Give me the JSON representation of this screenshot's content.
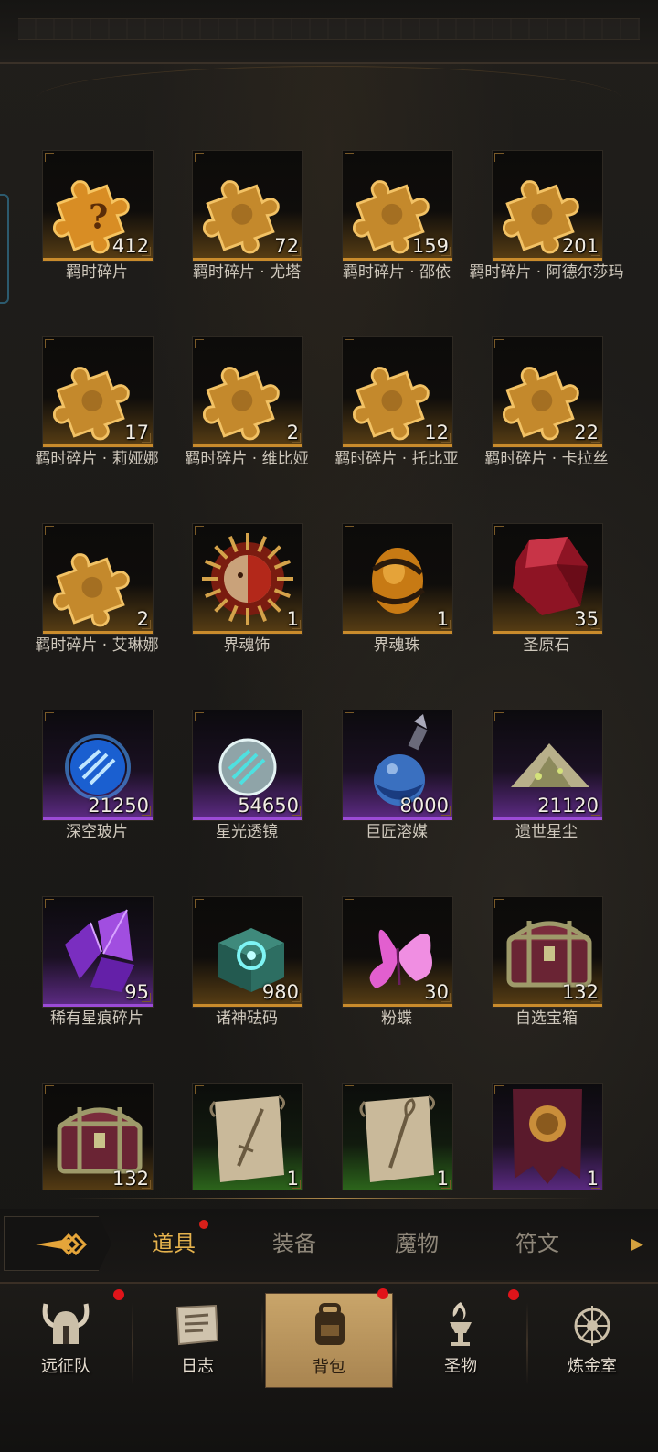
{
  "inventory": {
    "items": [
      {
        "label": "羁时碎片",
        "count": "412",
        "icon": "puzzle-question-icon",
        "rarity": "gold"
      },
      {
        "label": "羁时碎片 · 尤塔",
        "count": "72",
        "icon": "puzzle-piece-icon",
        "rarity": "gold"
      },
      {
        "label": "羁时碎片 · 邵依",
        "count": "159",
        "icon": "puzzle-piece-icon",
        "rarity": "gold"
      },
      {
        "label": "羁时碎片 · 阿德尔莎玛",
        "count": "201",
        "icon": "puzzle-piece-icon",
        "rarity": "gold"
      },
      {
        "label": "羁时碎片 · 莉娅娜",
        "count": "17",
        "icon": "puzzle-piece-icon",
        "rarity": "gold"
      },
      {
        "label": "羁时碎片 · 维比娅",
        "count": "2",
        "icon": "puzzle-piece-icon",
        "rarity": "gold"
      },
      {
        "label": "羁时碎片 · 托比亚",
        "count": "12",
        "icon": "puzzle-piece-icon",
        "rarity": "gold"
      },
      {
        "label": "羁时碎片 · 卡拉丝",
        "count": "22",
        "icon": "puzzle-piece-icon",
        "rarity": "gold"
      },
      {
        "label": "羁时碎片 · 艾琳娜",
        "count": "2",
        "icon": "puzzle-piece-icon",
        "rarity": "gold"
      },
      {
        "label": "界魂饰",
        "count": "1",
        "icon": "sun-mask-icon",
        "rarity": "gold"
      },
      {
        "label": "界魂珠",
        "count": "1",
        "icon": "amber-orb-icon",
        "rarity": "gold"
      },
      {
        "label": "圣原石",
        "count": "35",
        "icon": "red-gem-icon",
        "rarity": "gold"
      },
      {
        "label": "深空玻片",
        "count": "21250",
        "icon": "blue-orb-icon",
        "rarity": "purple"
      },
      {
        "label": "星光透镜",
        "count": "54650",
        "icon": "silver-orb-icon",
        "rarity": "purple"
      },
      {
        "label": "巨匠溶媒",
        "count": "8000",
        "icon": "potion-flask-icon",
        "rarity": "purple"
      },
      {
        "label": "遗世星尘",
        "count": "21120",
        "icon": "dust-pile-icon",
        "rarity": "purple"
      },
      {
        "label": "稀有星痕碎片",
        "count": "95",
        "icon": "purple-crystal-icon",
        "rarity": "purple"
      },
      {
        "label": "诸神砝码",
        "count": "980",
        "icon": "jade-cube-icon",
        "rarity": "gold"
      },
      {
        "label": "粉蝶",
        "count": "30",
        "icon": "pink-butterfly-icon",
        "rarity": "gold"
      },
      {
        "label": "自选宝箱",
        "count": "132",
        "icon": "treasure-chest-icon",
        "rarity": "gold"
      },
      {
        "label": "",
        "count": "132",
        "icon": "treasure-chest-icon",
        "rarity": "gold"
      },
      {
        "label": "",
        "count": "1",
        "icon": "sword-scroll-icon",
        "rarity": "green"
      },
      {
        "label": "",
        "count": "1",
        "icon": "staff-scroll-icon",
        "rarity": "green"
      },
      {
        "label": "",
        "count": "1",
        "icon": "lion-banner-icon",
        "rarity": "purple"
      }
    ]
  },
  "tabs": [
    {
      "label": "道具",
      "active": true,
      "badge": true
    },
    {
      "label": "装备",
      "active": false,
      "badge": false
    },
    {
      "label": "魔物",
      "active": false,
      "badge": false
    },
    {
      "label": "符文",
      "active": false,
      "badge": false
    }
  ],
  "nav": [
    {
      "label": "远征队",
      "icon": "viking-helmet-icon",
      "badge": true,
      "active": false
    },
    {
      "label": "日志",
      "icon": "journal-scroll-icon",
      "badge": false,
      "active": false
    },
    {
      "label": "背包",
      "icon": "backpack-icon",
      "badge": true,
      "active": true
    },
    {
      "label": "圣物",
      "icon": "torch-icon",
      "badge": true,
      "active": false
    },
    {
      "label": "炼金室",
      "icon": "alchemy-symbol-icon",
      "badge": false,
      "active": false
    }
  ],
  "colors": {
    "accent_gold": "#e5b24d",
    "badge_red": "#d9201a",
    "rarity_gold": "#c98b2c",
    "rarity_purple": "#9b4bd6",
    "rarity_green": "#52b53a"
  }
}
